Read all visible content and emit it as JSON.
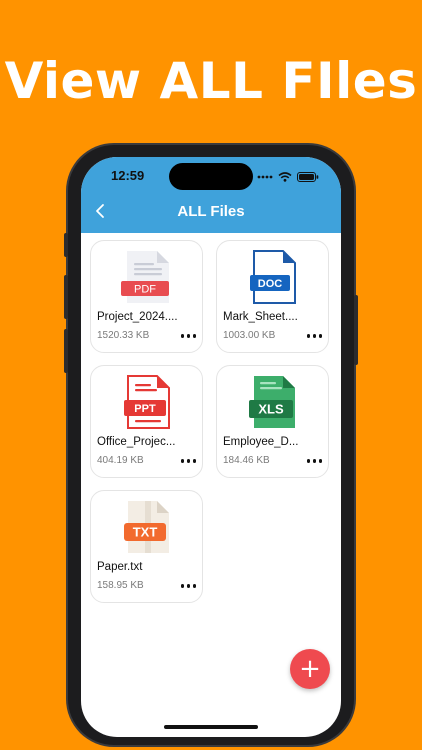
{
  "headline": "View ALL FIles",
  "status_bar": {
    "time": "12:59"
  },
  "app_bar": {
    "title": "ALL Files"
  },
  "files": [
    {
      "name": "Project_2024....",
      "size": "1520.33 KB",
      "type": "PDF",
      "label": "PDF",
      "color": "#E84C50"
    },
    {
      "name": "Mark_Sheet....",
      "size": "1003.00 KB",
      "type": "DOC",
      "label": "DOC",
      "color": "#1565C0"
    },
    {
      "name": "Office_Projec...",
      "size": "404.19 KB",
      "type": "PPT",
      "label": "PPT",
      "color": "#E53935"
    },
    {
      "name": "Employee_D...",
      "size": "184.46 KB",
      "type": "XLS",
      "label": "XLS",
      "color": "#2E8B57"
    },
    {
      "name": "Paper.txt",
      "size": "158.95 KB",
      "type": "TXT",
      "label": "TXT",
      "color": "#F26A2E"
    }
  ],
  "fab": {
    "label": "+"
  },
  "colors": {
    "background": "#FF9300",
    "app_bar": "#3FA2DB",
    "fab": "#EF4A4F"
  },
  "icons": [
    "back-chevron-icon",
    "signal-icon",
    "wifi-icon",
    "battery-icon",
    "more-dots-icon"
  ]
}
